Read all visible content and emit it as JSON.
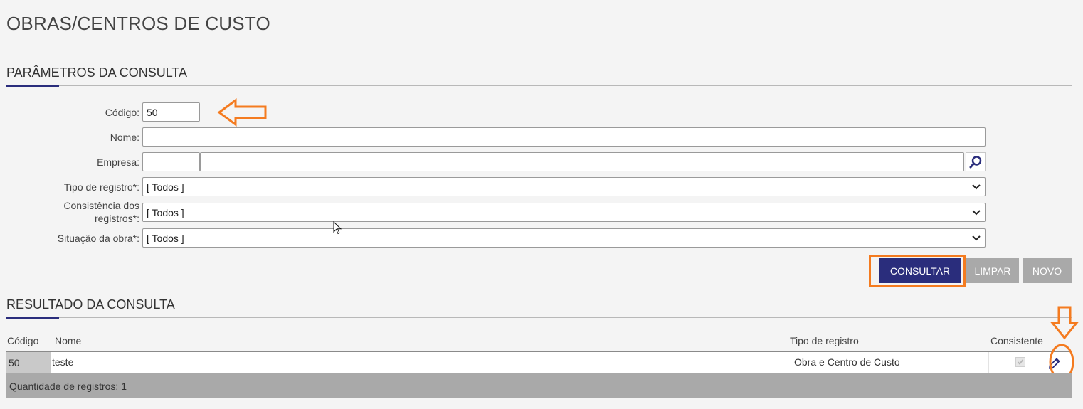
{
  "page": {
    "title": "OBRAS/CENTROS DE CUSTO"
  },
  "parameters": {
    "title": "PARÂMETROS DA CONSULTA",
    "codigo": {
      "label": "Código:",
      "value": "50"
    },
    "nome": {
      "label": "Nome:",
      "value": ""
    },
    "empresa": {
      "label": "Empresa:",
      "code_value": "",
      "name_value": ""
    },
    "tipo_registro": {
      "label": "Tipo de registro*:",
      "value": "[ Todos ]"
    },
    "consistencia": {
      "label_line1": "Consistência dos",
      "label_line2": "registros*:",
      "value": "[ Todos ]"
    },
    "situacao": {
      "label": "Situação da obra*:",
      "value": "[ Todos ]"
    }
  },
  "actions": {
    "consultar": "CONSULTAR",
    "limpar": "LIMPAR",
    "novo": "NOVO"
  },
  "results": {
    "title": "RESULTADO DA CONSULTA",
    "columns": {
      "codigo": "Código",
      "nome": "Nome",
      "tipo": "Tipo de registro",
      "consistente": "Consistente"
    },
    "rows": [
      {
        "codigo": "50",
        "nome": "teste",
        "tipo": "Obra e Centro de Custo",
        "consistente": true
      }
    ],
    "footer": "Quantidade de registros: 1"
  },
  "colors": {
    "accent": "#2a2d7c",
    "annotation": "#f47b20",
    "button_gray": "#a9a9a9"
  }
}
